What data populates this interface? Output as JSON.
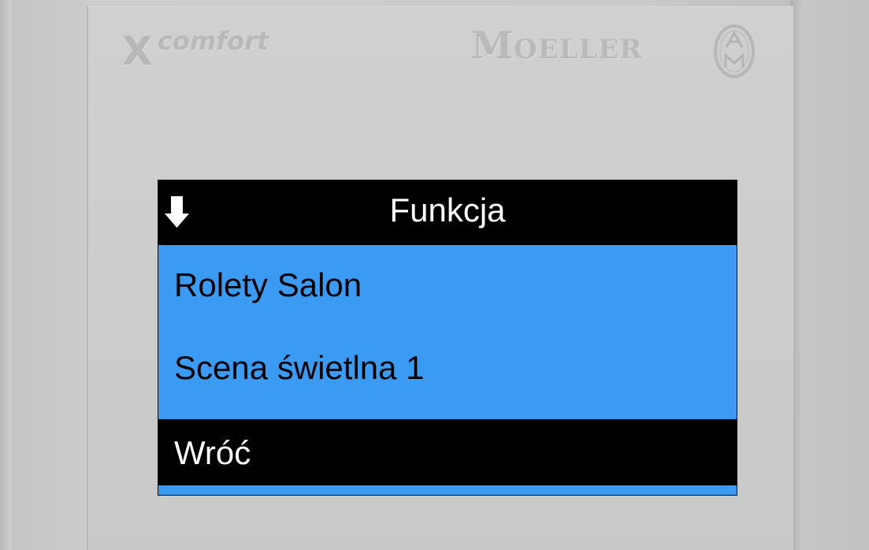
{
  "branding": {
    "logo_x": "X",
    "logo_comfort": "comfort",
    "manufacturer": "Moeller",
    "emblem_icon": "moeller-am-emblem-icon"
  },
  "display": {
    "header": {
      "icon": "down-arrow-icon",
      "title": "Funkcja"
    },
    "menu_items": [
      {
        "label": "Rolety Salon"
      },
      {
        "label": "Scena świetlna 1"
      }
    ],
    "selected_item": {
      "label": "Wróć"
    },
    "colors": {
      "background": "#3b9bf3",
      "header": "#000000",
      "selection": "#000000",
      "text": "#000000",
      "inverse_text": "#ffffff"
    }
  }
}
